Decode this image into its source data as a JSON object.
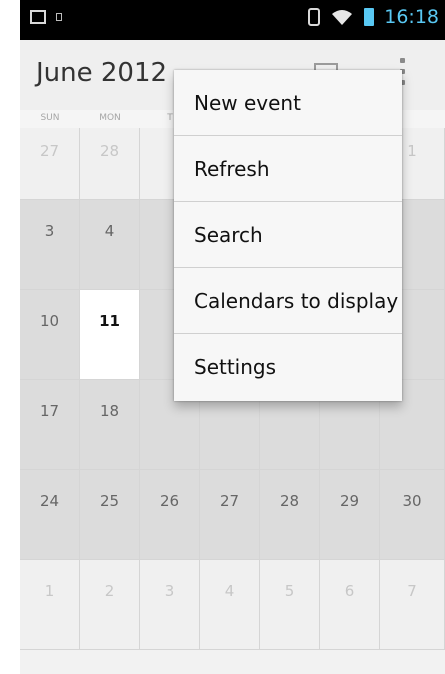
{
  "status_bar": {
    "time": "16:18",
    "icons": [
      "screenshot-icon",
      "notification-icon",
      "bluetooth-icon",
      "wifi-icon",
      "battery-icon"
    ],
    "accent_color": "#59c8f3"
  },
  "action_bar": {
    "title": "June 2012",
    "icons": [
      "calendar-today-icon",
      "overflow-menu-icon"
    ]
  },
  "calendar": {
    "weekdays": [
      "SUN",
      "MON",
      "T"
    ],
    "weeks": [
      [
        {
          "day": "27",
          "style": "faded"
        },
        {
          "day": "28",
          "style": "faded"
        },
        {
          "day": "",
          "style": "faded"
        },
        {
          "day": "",
          "style": "faded"
        },
        {
          "day": "",
          "style": "faded"
        },
        {
          "day": "",
          "style": "faded"
        },
        {
          "day": "1",
          "style": "faded"
        }
      ],
      [
        {
          "day": "3",
          "style": "dark"
        },
        {
          "day": "4",
          "style": "dark"
        },
        {
          "day": "",
          "style": "dark"
        },
        {
          "day": "",
          "style": "dark"
        },
        {
          "day": "",
          "style": "dark"
        },
        {
          "day": "",
          "style": "dark"
        },
        {
          "day": "",
          "style": "dark"
        }
      ],
      [
        {
          "day": "10",
          "style": "dark"
        },
        {
          "day": "11",
          "style": "today"
        },
        {
          "day": "",
          "style": "dark"
        },
        {
          "day": "",
          "style": "dark"
        },
        {
          "day": "",
          "style": "dark"
        },
        {
          "day": "",
          "style": "dark"
        },
        {
          "day": "",
          "style": "dark"
        }
      ],
      [
        {
          "day": "17",
          "style": "dark"
        },
        {
          "day": "18",
          "style": "dark"
        },
        {
          "day": "",
          "style": "dark"
        },
        {
          "day": "",
          "style": "dark"
        },
        {
          "day": "",
          "style": "dark"
        },
        {
          "day": "",
          "style": "dark"
        },
        {
          "day": "",
          "style": "dark"
        }
      ],
      [
        {
          "day": "24",
          "style": "dark"
        },
        {
          "day": "25",
          "style": "dark"
        },
        {
          "day": "26",
          "style": "dark"
        },
        {
          "day": "27",
          "style": "dark"
        },
        {
          "day": "28",
          "style": "dark"
        },
        {
          "day": "29",
          "style": "dark"
        },
        {
          "day": "30",
          "style": "dark"
        }
      ],
      [
        {
          "day": "1",
          "style": "faded"
        },
        {
          "day": "2",
          "style": "faded"
        },
        {
          "day": "3",
          "style": "faded"
        },
        {
          "day": "4",
          "style": "faded"
        },
        {
          "day": "5",
          "style": "faded"
        },
        {
          "day": "6",
          "style": "faded"
        },
        {
          "day": "7",
          "style": "faded"
        }
      ]
    ]
  },
  "menu": {
    "items": [
      {
        "label": "New event"
      },
      {
        "label": "Refresh"
      },
      {
        "label": "Search"
      },
      {
        "label": "Calendars to display"
      },
      {
        "label": "Settings"
      }
    ]
  }
}
